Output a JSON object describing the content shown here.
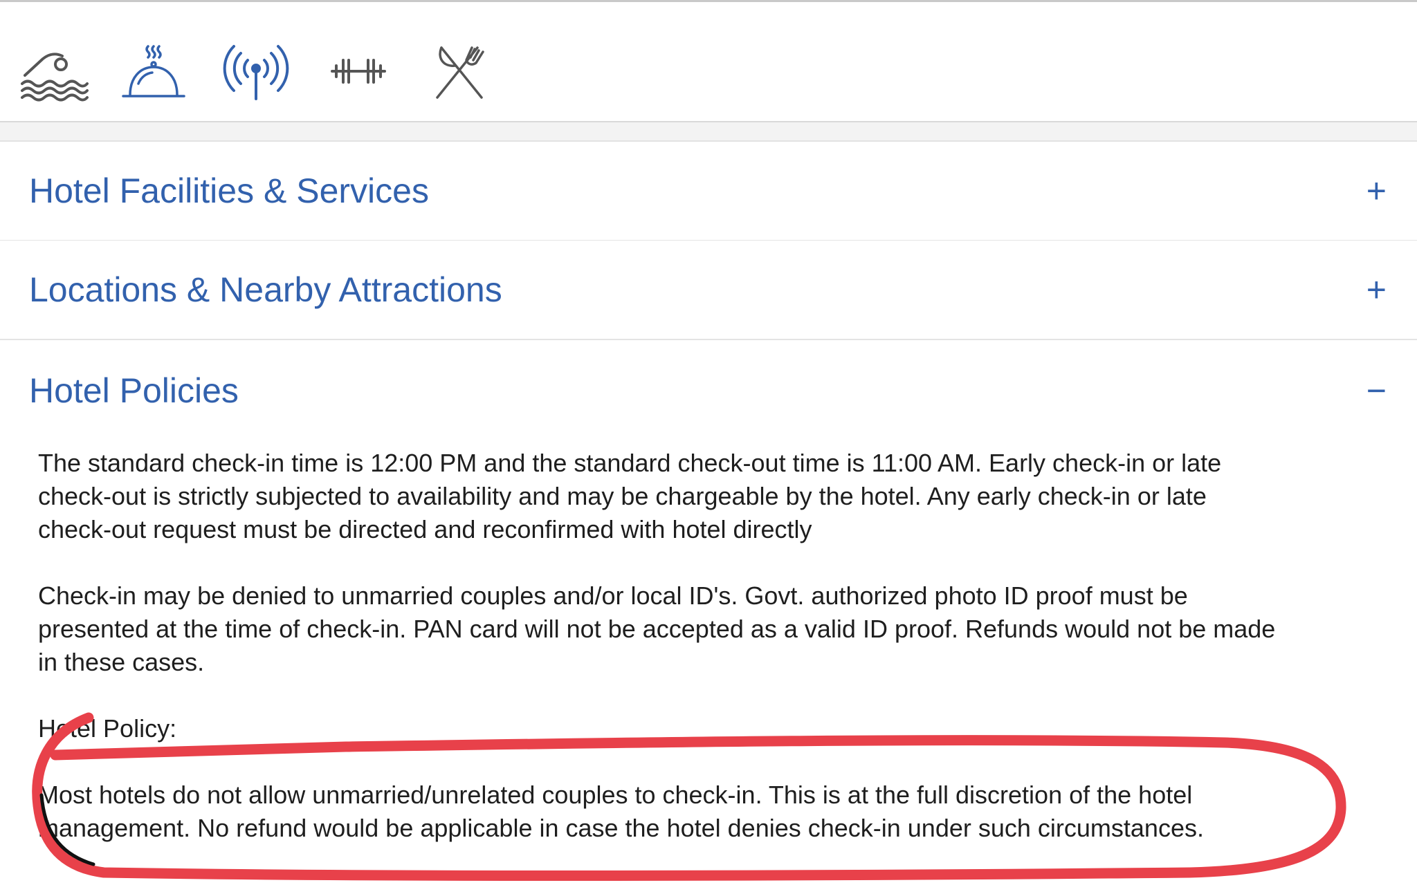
{
  "amenities": {
    "icons": [
      "swimming-pool-icon",
      "room-service-icon",
      "wifi-icon",
      "gym-icon",
      "restaurant-icon"
    ],
    "color": "#3261ad",
    "neutral_color": "#555555"
  },
  "accordion": {
    "sections": [
      {
        "title": "Hotel Facilities & Services",
        "toggle": "+",
        "expanded": false
      },
      {
        "title": "Locations & Nearby Attractions",
        "toggle": "+",
        "expanded": false
      },
      {
        "title": "Hotel Policies",
        "toggle": "−",
        "expanded": true
      }
    ]
  },
  "policies": {
    "check_in_lines": [
      "The standard check-in time is 12:00 PM and the standard check-out time is 11:00 AM. Early check-in or late",
      "check-out is strictly subjected to availability and may be chargeable by the hotel. Any early check-in or late",
      "check-out request must be directed and reconfirmed with hotel directly"
    ],
    "id_lines": [
      "Check-in may be denied to unmarried couples and/or local ID's. Govt. authorized photo ID proof must be",
      "presented at the time of check-in. PAN card will not be accepted as a valid ID proof. Refunds would not be made",
      "in these cases."
    ],
    "hotel_policy_label": "Hotel Policy:",
    "couples_lines": [
      "Most hotels do not allow unmarried/unrelated couples to check-in. This is at the full discretion of the hotel",
      "management. No refund would be applicable in case the hotel denies check-in under such circumstances."
    ]
  },
  "annotation": {
    "stroke_color": "#e8414a"
  }
}
